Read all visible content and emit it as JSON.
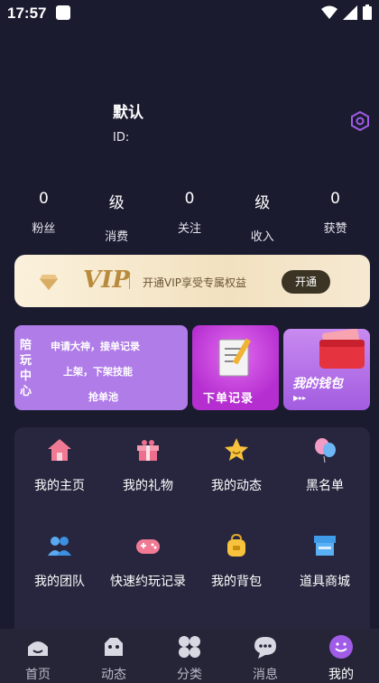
{
  "status_bar": {
    "time": "17:57"
  },
  "profile": {
    "name": "默认",
    "id_label": "ID:"
  },
  "stats": [
    {
      "value": "0",
      "label": "粉丝"
    },
    {
      "value": "级",
      "label": "消费"
    },
    {
      "value": "0",
      "label": "关注"
    },
    {
      "value": "级",
      "label": "收入"
    },
    {
      "value": "0",
      "label": "获赞"
    }
  ],
  "vip_banner": {
    "title": "VIP",
    "description": "开通VIP享受专属权益",
    "button": "开通"
  },
  "promo_card": {
    "vertical_title": "陪玩中心",
    "lines": [
      "申请大神，接单记录",
      "上架，下架技能",
      "抢单池"
    ]
  },
  "order_card": {
    "label": "下单记录"
  },
  "wallet_card": {
    "label": "我的钱包"
  },
  "menu": [
    {
      "label": "我的主页",
      "icon": "home-icon"
    },
    {
      "label": "我的礼物",
      "icon": "gift-icon"
    },
    {
      "label": "我的动态",
      "icon": "star-icon"
    },
    {
      "label": "黑名单",
      "icon": "balloon-icon"
    },
    {
      "label": "我的团队",
      "icon": "team-icon"
    },
    {
      "label": "快速约玩记录",
      "icon": "gamepad-icon"
    },
    {
      "label": "我的背包",
      "icon": "backpack-icon"
    },
    {
      "label": "道具商城",
      "icon": "store-icon"
    }
  ],
  "tabs": [
    {
      "label": "首页",
      "icon": "home-tab-icon"
    },
    {
      "label": "动态",
      "icon": "moments-tab-icon"
    },
    {
      "label": "分类",
      "icon": "category-tab-icon"
    },
    {
      "label": "消息",
      "icon": "message-tab-icon"
    },
    {
      "label": "我的",
      "icon": "mine-tab-icon",
      "active": true
    }
  ],
  "colors": {
    "background": "#1b1b30",
    "accent": "#a05ce6",
    "vip_gold": "#b88a3c"
  }
}
